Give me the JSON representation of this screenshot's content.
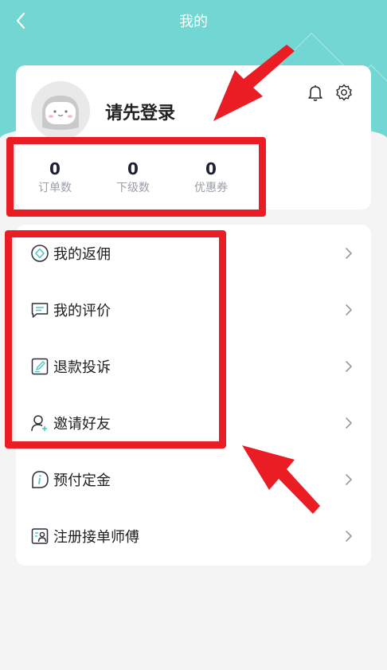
{
  "header": {
    "title": "我的"
  },
  "profile": {
    "login_prompt": "请先登录",
    "stats": [
      {
        "value": "0",
        "label": "订单数"
      },
      {
        "value": "0",
        "label": "下级数"
      },
      {
        "value": "0",
        "label": "优惠券"
      }
    ]
  },
  "menu": [
    {
      "label": "我的返佣",
      "icon": "rebate-icon"
    },
    {
      "label": "我的评价",
      "icon": "comment-icon"
    },
    {
      "label": "退款投诉",
      "icon": "refund-complaint-icon"
    },
    {
      "label": "邀请好友",
      "icon": "invite-user-icon"
    },
    {
      "label": "预付定金",
      "icon": "deposit-info-icon"
    },
    {
      "label": "注册接单师傅",
      "icon": "register-master-icon"
    }
  ],
  "colors": {
    "accent": "#72d6d3",
    "annotation_red": "#ea1d25"
  }
}
